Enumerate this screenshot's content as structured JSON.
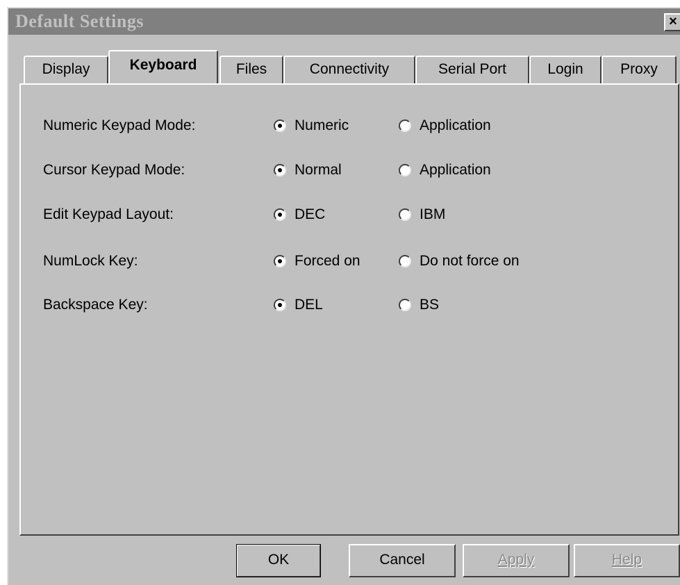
{
  "window": {
    "title": "Default Settings",
    "close_glyph": "×"
  },
  "tabs": [
    {
      "label": "Display",
      "active": false
    },
    {
      "label": "Keyboard",
      "active": true
    },
    {
      "label": "Files",
      "active": false
    },
    {
      "label": "Connectivity",
      "active": false
    },
    {
      "label": "Serial Port",
      "active": false
    },
    {
      "label": "Login",
      "active": false
    },
    {
      "label": "Proxy",
      "active": false
    }
  ],
  "settings": [
    {
      "label": "Numeric Keypad Mode:",
      "option1": "Numeric",
      "option2": "Application",
      "selected": 1
    },
    {
      "label": "Cursor Keypad Mode:",
      "option1": "Normal",
      "option2": "Application",
      "selected": 1
    },
    {
      "label": "Edit Keypad Layout:",
      "option1": "DEC",
      "option2": "IBM",
      "selected": 1
    },
    {
      "label": "NumLock Key:",
      "option1": "Forced on",
      "option2": "Do not force on",
      "selected": 1
    },
    {
      "label": "Backspace Key:",
      "option1": "DEL",
      "option2": "BS",
      "selected": 1
    }
  ],
  "buttons": {
    "ok": "OK",
    "cancel": "Cancel",
    "apply": "Apply",
    "help": "Help"
  },
  "colors": {
    "face": "#c0c0c0",
    "titlebar_inactive": "#808080",
    "disabled_text": "#8a8a8a"
  }
}
